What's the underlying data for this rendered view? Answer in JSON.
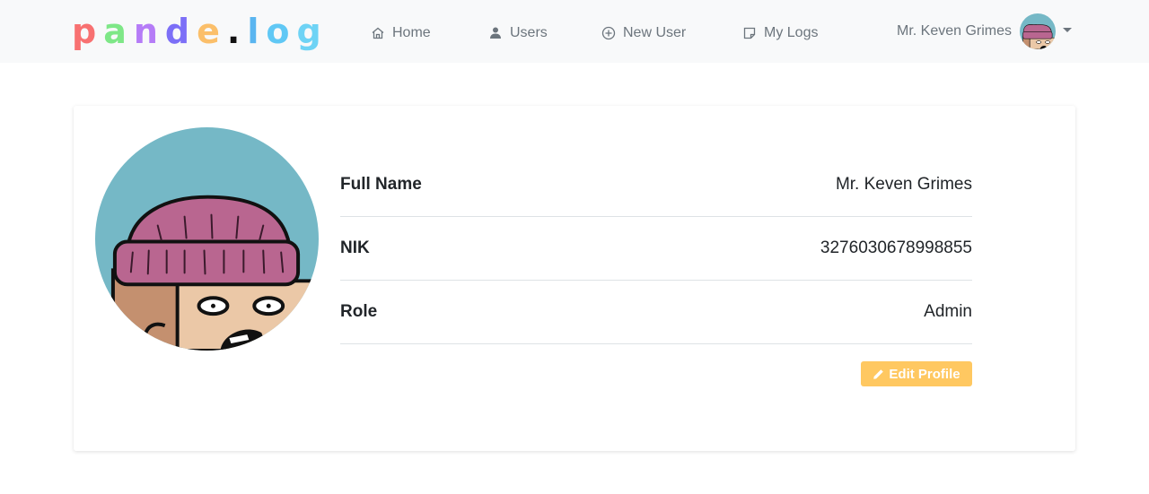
{
  "brand": {
    "letters": [
      "p",
      "a",
      "n",
      "d",
      "e",
      ".",
      "l",
      "o",
      "g"
    ],
    "colors": [
      "#f87171",
      "#7ee787",
      "#b57cf7",
      "#7c6ff7",
      "#fbbf6a",
      "#111111",
      "#5ab5f0",
      "#60c8f5",
      "#6ed3f5"
    ]
  },
  "nav": {
    "home": "Home",
    "users": "Users",
    "new_user": "New User",
    "my_logs": "My Logs"
  },
  "user_menu": {
    "name": "Mr. Keven Grimes"
  },
  "profile": {
    "rows": [
      {
        "label": "Full Name",
        "value": "Mr. Keven Grimes"
      },
      {
        "label": "NIK",
        "value": "3276030678998855"
      },
      {
        "label": "Role",
        "value": "Admin"
      }
    ],
    "edit_label": "Edit Profile"
  },
  "colors": {
    "navbar_bg": "#f8f9fa",
    "nav_text": "#6c757d",
    "avatar_bg": "#75b8c6",
    "beanie": "#b96690",
    "button": "#ffc861"
  },
  "icons": {
    "home": "home-icon",
    "users": "user-icon",
    "new_user": "plus-circle-icon",
    "my_logs": "note-icon",
    "edit": "pencil-icon",
    "dropdown": "caret-down-icon"
  }
}
